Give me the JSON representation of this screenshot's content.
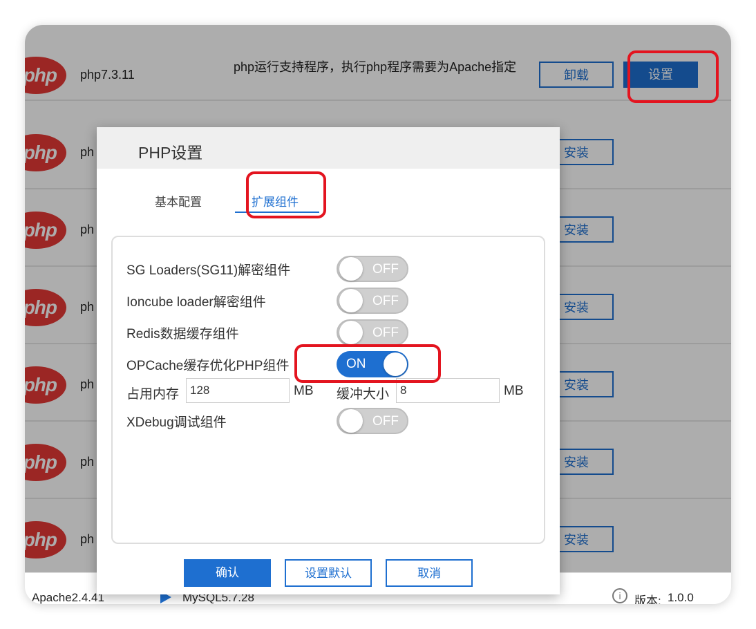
{
  "list": {
    "top_item": {
      "logo": "php",
      "name": "php7.3.11",
      "description": "php运行支持程序，执行php程序需要为Apache指定",
      "uninstall_label": "卸载",
      "settings_label": "设置"
    },
    "rows": [
      {
        "logo": "php",
        "name": "ph",
        "install_label": "安装"
      },
      {
        "logo": "php",
        "name": "ph",
        "install_label": "安装"
      },
      {
        "logo": "php",
        "name": "ph",
        "install_label": "安装"
      },
      {
        "logo": "php",
        "name": "ph",
        "install_label": "安装"
      },
      {
        "logo": "php",
        "name": "ph",
        "install_label": "安装"
      },
      {
        "logo": "php",
        "name": "ph",
        "install_label": "安装"
      }
    ]
  },
  "footer": {
    "apache": "Apache2.4.41",
    "mysql": "MySQL5.7.28",
    "version_label": "版本:",
    "version_value": "1.0.0"
  },
  "dialog": {
    "title": "PHP设置",
    "tabs": [
      {
        "label": "基本配置",
        "active": false
      },
      {
        "label": "扩展组件",
        "active": true
      }
    ],
    "extensions": [
      {
        "label": "SG Loaders(SG11)解密组件",
        "state": "OFF"
      },
      {
        "label": "Ioncube loader解密组件",
        "state": "OFF"
      },
      {
        "label": "Redis数据缓存组件",
        "state": "OFF"
      },
      {
        "label": "OPCache缓存优化PHP组件",
        "state": "ON"
      },
      {
        "label": "XDebug调试组件",
        "state": "OFF"
      }
    ],
    "opcache": {
      "memory_label": "占用内存",
      "memory_value": "128",
      "memory_unit": "MB",
      "buffer_label": "缓冲大小",
      "buffer_value": "8",
      "buffer_unit": "MB"
    },
    "buttons": {
      "confirm": "确认",
      "set_default": "设置默认",
      "cancel": "取消"
    }
  },
  "colors": {
    "accent": "#1e6fd0",
    "highlight_box": "#e3141f",
    "php_logo": "#e53935"
  }
}
